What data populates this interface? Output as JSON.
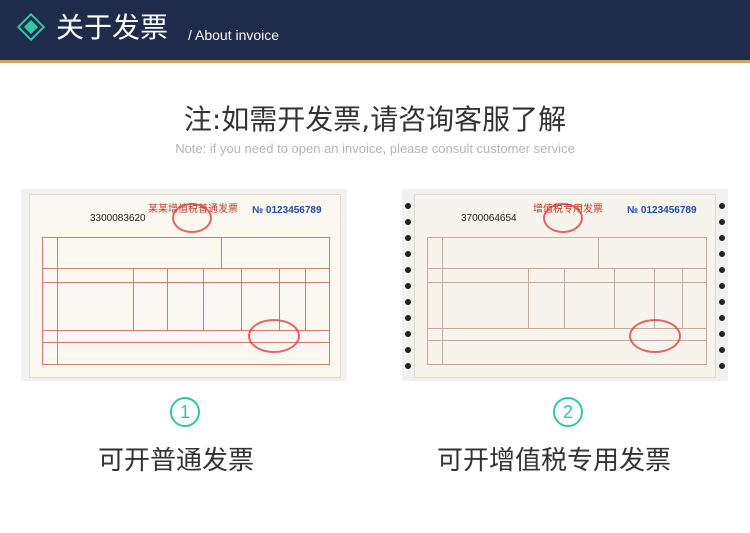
{
  "header": {
    "title_cn": "关于发票",
    "title_en": "/ About invoice",
    "accent_color": "#2fc7a5",
    "bg_color": "#1f2b4a"
  },
  "note": {
    "cn": "注:如需开发票,请咨询客服了解",
    "en": "Note: if you need to open an invoice, please consult customer service"
  },
  "invoices": [
    {
      "number": "1",
      "badge": "①",
      "label": "可开普通发票",
      "invoice_code": "3300083620",
      "invoice_title": "某某增值税普通发票",
      "invoice_no": "№ 0123456789"
    },
    {
      "number": "2",
      "badge": "②",
      "label": "可开增值税专用发票",
      "invoice_code": "3700064654",
      "invoice_title": "增值税专用发票",
      "invoice_no": "№ 0123456789"
    }
  ]
}
